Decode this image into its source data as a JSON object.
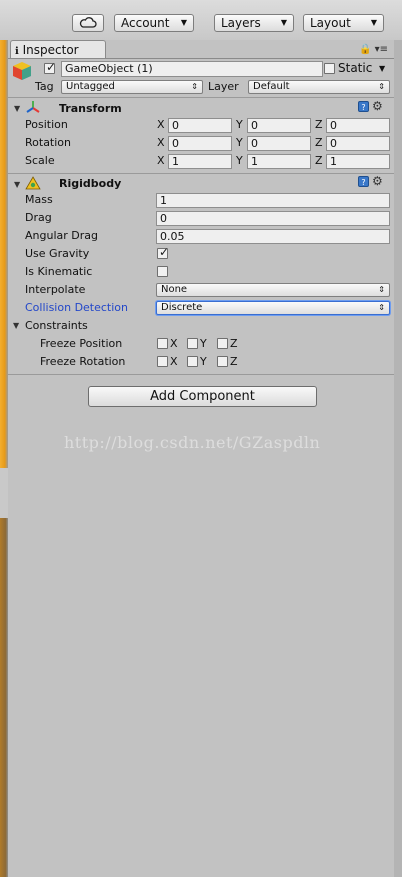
{
  "toolbar": {
    "cloud_icon": "cloud-icon",
    "account_label": "Account",
    "layers_label": "Layers",
    "layout_label": "Layout",
    "caret": "▼"
  },
  "inspector": {
    "tab_label": "Inspector",
    "tab_tools": "🔒 ▾≡",
    "gameobject": {
      "active_checked": true,
      "name": "GameObject (1)",
      "static_label": "Static",
      "static_caret": "▼",
      "tag_label": "Tag",
      "tag_value": "Untagged",
      "layer_label": "Layer",
      "layer_value": "Default",
      "dropdown_arrows": "⇕"
    },
    "transform": {
      "title": "Transform",
      "rows": [
        {
          "label": "Position",
          "x": "0",
          "y": "0",
          "z": "0"
        },
        {
          "label": "Rotation",
          "x": "0",
          "y": "0",
          "z": "0"
        },
        {
          "label": "Scale",
          "x": "1",
          "y": "1",
          "z": "1"
        }
      ],
      "axis_x": "X",
      "axis_y": "Y",
      "axis_z": "Z"
    },
    "rigidbody": {
      "title": "Rigidbody",
      "mass_label": "Mass",
      "mass_value": "1",
      "drag_label": "Drag",
      "drag_value": "0",
      "angular_drag_label": "Angular Drag",
      "angular_drag_value": "0.05",
      "use_gravity_label": "Use Gravity",
      "use_gravity_checked": true,
      "is_kinematic_label": "Is Kinematic",
      "is_kinematic_checked": false,
      "interpolate_label": "Interpolate",
      "interpolate_value": "None",
      "collision_label": "Collision Detection",
      "collision_value": "Discrete",
      "constraints_label": "Constraints",
      "freeze_position_label": "Freeze Position",
      "freeze_rotation_label": "Freeze Rotation",
      "axis_x": "X",
      "axis_y": "Y",
      "axis_z": "Z"
    },
    "help_glyph": "?",
    "gear_glyph": "⚙",
    "fold_open": "▼",
    "add_component_label": "Add Component"
  },
  "watermark": "http://blog.csdn.net/GZaspdln",
  "colors": {
    "panel_bg": "#c2c2c2",
    "highlight_label": "#2347c9",
    "left_strip": "#e69a19"
  }
}
